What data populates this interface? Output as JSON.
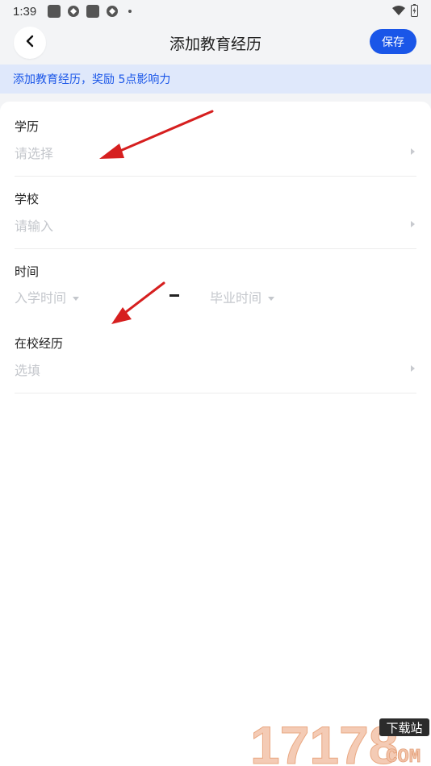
{
  "status_bar": {
    "time": "1:39"
  },
  "header": {
    "title": "添加教育经历",
    "save_label": "保存"
  },
  "banner": {
    "text": "添加教育经历，奖励 5点影响力"
  },
  "form": {
    "degree": {
      "label": "学历",
      "placeholder": "请选择"
    },
    "school": {
      "label": "学校",
      "placeholder": "请输入"
    },
    "time": {
      "label": "时间",
      "start_placeholder": "入学时间",
      "end_placeholder": "毕业时间"
    },
    "experience": {
      "label": "在校经历",
      "placeholder": "选填"
    }
  },
  "colors": {
    "accent": "#1a56e8",
    "banner_bg": "#dfe8fb",
    "annotation": "#e02020"
  },
  "watermark": {
    "number": "17178",
    "tag": "下载站",
    "domain": "COM"
  }
}
